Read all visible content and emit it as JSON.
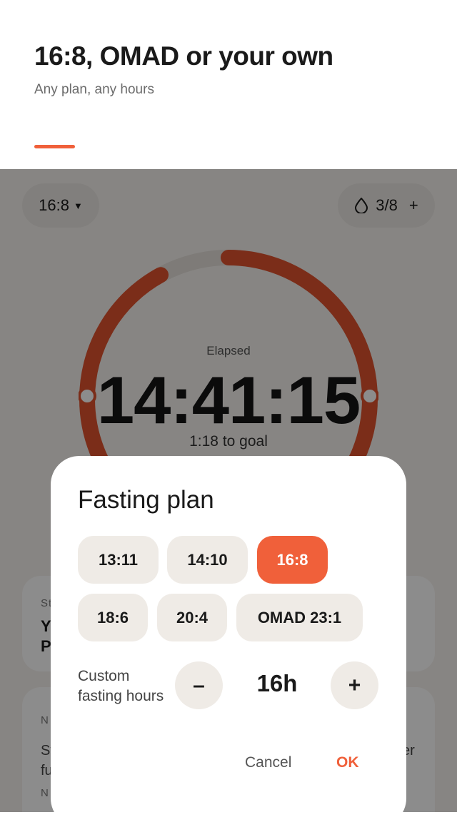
{
  "promo": {
    "title": "16:8, OMAD or your own",
    "subtitle": "Any plan, any hours",
    "accent_color": "#f0603a"
  },
  "app": {
    "plan_selector": {
      "label": "16:8",
      "icon": "caret-down-icon"
    },
    "water": {
      "icon": "water-drop-icon",
      "count": "3/8",
      "add_label": "+"
    },
    "timer": {
      "label": "Elapsed",
      "time": "14:41:15",
      "to_goal": "1:18 to goal",
      "progress_fraction": 0.92,
      "ring_color": "#e0532f",
      "track_color": "#e6e1db"
    },
    "cards": {
      "card1_small": "St",
      "card1_line1": "Y",
      "card1_line2": "P",
      "card2_small": "N",
      "card2_line1": "St",
      "card2_line2": "fu",
      "card2_right": "er",
      "card2_small2": "N"
    }
  },
  "dialog": {
    "title": "Fasting plan",
    "presets": [
      {
        "label": "13:11",
        "selected": false
      },
      {
        "label": "14:10",
        "selected": false
      },
      {
        "label": "16:8",
        "selected": true
      },
      {
        "label": "18:6",
        "selected": false
      },
      {
        "label": "20:4",
        "selected": false
      },
      {
        "label": "OMAD 23:1",
        "selected": false
      }
    ],
    "custom_label": "Custom fasting hours",
    "minus_label": "–",
    "plus_label": "+",
    "hours_value": "16h",
    "cancel_label": "Cancel",
    "ok_label": "OK"
  }
}
